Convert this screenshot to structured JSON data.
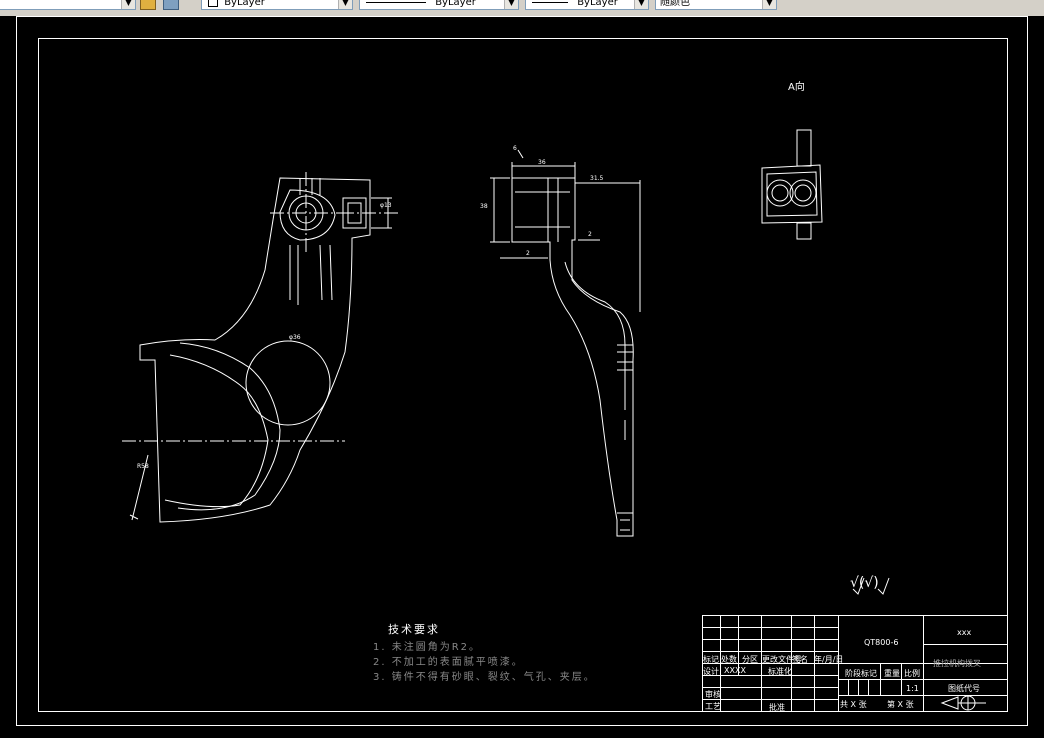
{
  "toolbar": {
    "items": [
      {
        "label": ""
      },
      {
        "label": "ByLayer"
      },
      {
        "label": "ByLayer"
      },
      {
        "label": "ByLayer"
      },
      {
        "label": "随颜色"
      }
    ]
  },
  "drawing": {
    "view_label": "A向",
    "dims": {
      "d1": "36",
      "d2": "31.5",
      "d3": "38",
      "d4": "2",
      "d5": "2",
      "d6": "φ13",
      "d7": "φ36",
      "d8": "R58",
      "d9": "6"
    },
    "roughness": "√(√)",
    "requirements": {
      "title": "技术要求",
      "lines": [
        "1. 未注圆角为R2。",
        "2. 不加工的表面腻平喷漆。",
        "3. 铸件不得有砂眼、裂纹、气孔、夹层。"
      ]
    },
    "title_block": {
      "material": "QT800-6",
      "company": "xxx",
      "part_name": "推拉机构拨叉",
      "col_headers": [
        "标记",
        "处数",
        "分区",
        "更改文件号",
        "签名",
        "年/月/日"
      ],
      "design": "设计",
      "design_name": "XXXX",
      "standardize": "标准化",
      "stage": "阶段标记",
      "weight": "重量",
      "scale_label": "比例",
      "scale": "1:1",
      "check": "审核",
      "process": "工艺",
      "approve": "批准",
      "sheets": "共 X 张",
      "sheet_no": "第 X 张",
      "code": "图纸代号"
    }
  }
}
